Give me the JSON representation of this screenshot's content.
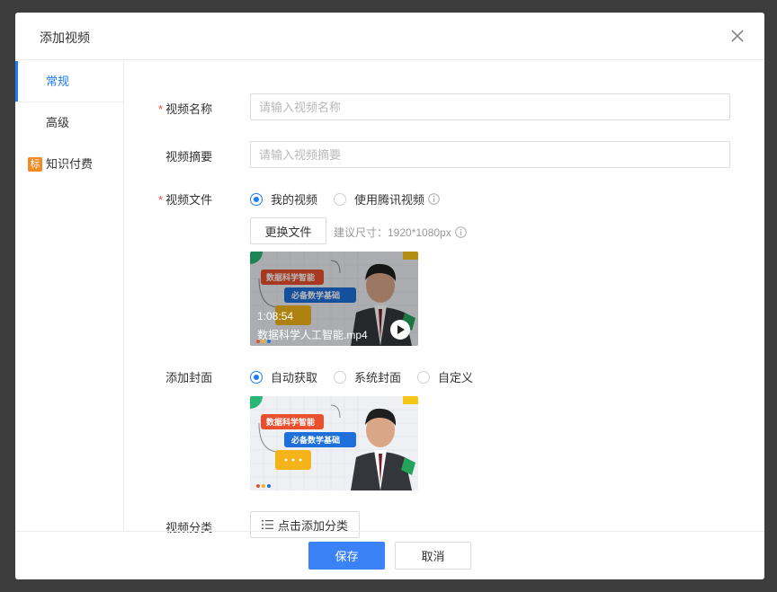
{
  "dialog": {
    "title": "添加视频"
  },
  "sidebar": {
    "items": [
      {
        "label": "常规"
      },
      {
        "label": "高级"
      },
      {
        "label": "知识付费",
        "badge": "标"
      }
    ]
  },
  "form": {
    "name": {
      "label": "视频名称",
      "required": "*",
      "placeholder": "请输入视频名称"
    },
    "summary": {
      "label": "视频摘要",
      "placeholder": "请输入视频摘要"
    },
    "file": {
      "label": "视频文件",
      "required": "*",
      "options": [
        "我的视频",
        "使用腾讯视频"
      ],
      "selected": "我的视频",
      "replace_label": "更换文件",
      "hint": "建议尺寸：1920*1080px",
      "video": {
        "duration": "1:08:54",
        "filename": "数据科学人工智能.mp4",
        "tag1": "数据科学智能",
        "tag2": "必备数学基础"
      }
    },
    "cover": {
      "label": "添加封面",
      "options": [
        "自动获取",
        "系统封面",
        "自定义"
      ],
      "selected": "自动获取",
      "image": {
        "tag1": "数据科学智能",
        "tag2": "必备数学基础"
      }
    },
    "category": {
      "label": "视频分类",
      "button_label": "点击添加分类"
    }
  },
  "footer": {
    "save_label": "保存",
    "cancel_label": "取消"
  },
  "colors": {
    "accent": "#1e7cf3",
    "primary_button": "#3b82f6",
    "required": "#e74c3c",
    "badge": "#f08a24"
  }
}
